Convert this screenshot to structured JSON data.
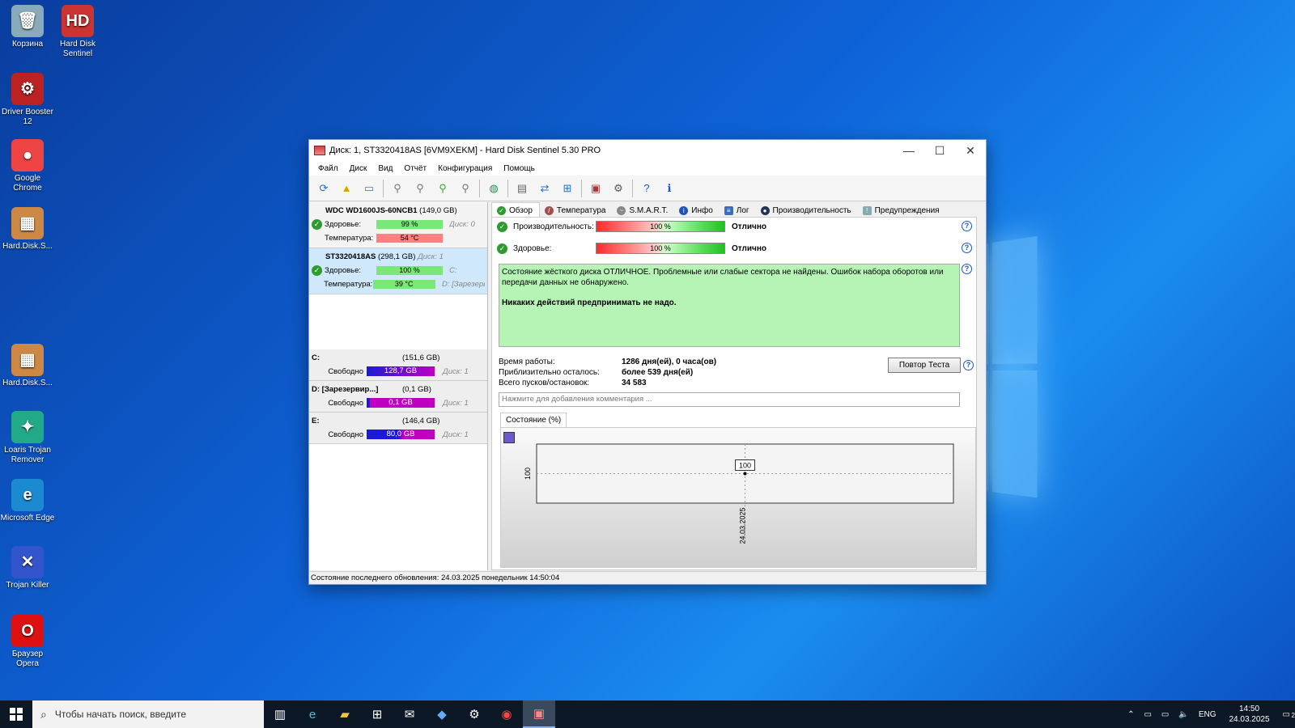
{
  "desktop": {
    "icons": [
      {
        "label": "Корзина",
        "glyph": "🗑"
      },
      {
        "label": "Hard Disk Sentinel",
        "glyph": "HD"
      },
      {
        "label": "Driver Booster 12",
        "glyph": "⚙"
      },
      {
        "label": "Google Chrome",
        "glyph": "●"
      },
      {
        "label": "Hard.Disk.S...",
        "glyph": "▦"
      },
      {
        "label": "Hard.Disk.S...",
        "glyph": "▦"
      },
      {
        "label": "Loaris Trojan Remover",
        "glyph": "✦"
      },
      {
        "label": "Microsoft Edge",
        "glyph": "e"
      },
      {
        "label": "Trojan Killer",
        "glyph": "✕"
      },
      {
        "label": "Браузер Opera",
        "glyph": "O"
      }
    ]
  },
  "window": {
    "title": "Диск: 1, ST3320418AS [6VM9XEKM]  -  Hard Disk Sentinel 5.30 PRO",
    "controls": {
      "minimize": "—",
      "maximize": "☐",
      "close": "✕"
    },
    "menu": [
      "Файл",
      "Диск",
      "Вид",
      "Отчёт",
      "Конфигурация",
      "Помощь"
    ],
    "status_bar": "Состояние последнего обновления: 24.03.2025 понедельник 14:50:04"
  },
  "toolbar": [
    "refresh-icon",
    "alert-icon",
    "disk-icon",
    "tool-icon",
    "tool-icon",
    "tool-icon",
    "tool-icon",
    "globe-icon",
    "doc-icon",
    "sync-icon",
    "network-icon",
    "chart-icon",
    "gear-icon",
    "help-icon",
    "info-icon"
  ],
  "disks": [
    {
      "name": "WDC WD1600JS-60NCB1",
      "capacity": "(149,0 GB)",
      "index": "",
      "health_label": "Здоровье:",
      "health": "99 %",
      "health_extra": "Диск: 0",
      "temp_label": "Температура:",
      "temp": "54 °C",
      "temp_extra": "",
      "selected": false,
      "health_color": "#79e879",
      "temp_color": "#ff8080"
    },
    {
      "name": "ST3320418AS",
      "capacity": "(298,1 GB)",
      "index": "Диск: 1",
      "health_label": "Здоровье:",
      "health": "100 %",
      "health_extra": "C:",
      "temp_label": "Температура:",
      "temp": "39 °C",
      "temp_extra": "D: [Зарезерв",
      "selected": true,
      "health_color": "#79e879",
      "temp_color": "#79e879"
    }
  ],
  "volumes": [
    {
      "name": "C:",
      "capacity": "(151,6 GB)",
      "free_label": "Свободно",
      "free": "128,7 GB",
      "disk": "Диск: 1"
    },
    {
      "name": "D: [Зарезервир...]",
      "capacity": "(0,1 GB)",
      "free_label": "Свободно",
      "free": "0,1 GB",
      "disk": "Диск: 1"
    },
    {
      "name": "E:",
      "capacity": "(146,4 GB)",
      "free_label": "Свободно",
      "free": "80,0 GB",
      "disk": "Диск: 1"
    }
  ],
  "tabs": [
    "Обзор",
    "Температура",
    "S.M.A.R.T.",
    "Инфо",
    "Лог",
    "Производительность",
    "Предупреждения"
  ],
  "overview": {
    "performance_label": "Производительность:",
    "performance_value": "100 %",
    "performance_status": "Отлично",
    "health_label": "Здоровье:",
    "health_value": "100 %",
    "health_status": "Отлично",
    "status_text": "Состояние жёсткого диска ОТЛИЧНОЕ. Проблемные или слабые сектора не найдены. Ошибок набора оборотов или передачи данных не обнаружено.",
    "status_bold": "Никаких действий предпринимать не надо.",
    "uptime_label": "Время работы:",
    "uptime_value": "1286 дня(ей), 0 часа(ов)",
    "remaining_label": "Приблизительно осталось:",
    "remaining_value": "более 539 дня(ей)",
    "starts_label": "Всего пусков/остановок:",
    "starts_value": "34 583",
    "retest_button": "Повтор Теста",
    "comment_placeholder": "Нажмите для добавления комментария ...",
    "chart_tab": "Состояние (%)"
  },
  "chart_data": {
    "type": "line",
    "x": [
      "24.03.2025"
    ],
    "series": [
      {
        "values": [
          100
        ]
      }
    ],
    "data_labels": [
      "100"
    ],
    "y_tick_labels": [
      "100"
    ],
    "grid": true
  },
  "taskbar": {
    "search_placeholder": "Чтобы начать поиск, введите",
    "apps": [
      "task-view-icon",
      "edge-icon",
      "explorer-icon",
      "store-icon",
      "mail-icon",
      "app-icon",
      "settings-icon",
      "chrome-icon",
      "hds-icon"
    ],
    "language": "ENG",
    "time": "14:50",
    "date": "24.03.2025",
    "notifications": "2"
  }
}
